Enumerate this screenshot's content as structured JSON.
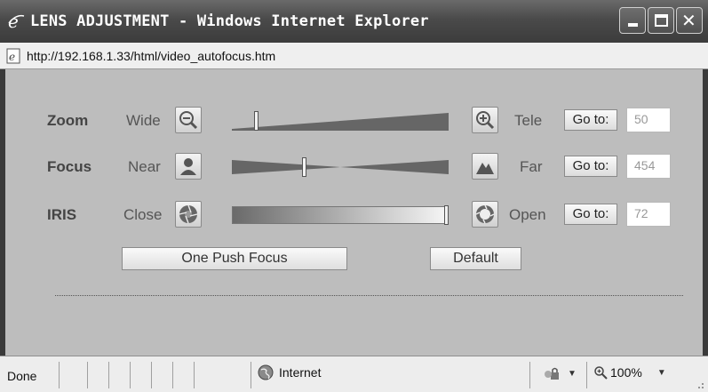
{
  "window": {
    "title": "LENS ADJUSTMENT - Windows Internet Explorer",
    "url": "http://192.168.1.33/html/video_autofocus.htm"
  },
  "controls": {
    "zoom": {
      "label": "Zoom",
      "min_label": "Wide",
      "max_label": "Tele",
      "goto_label": "Go to:",
      "value": "50",
      "position": 0.11,
      "min_icon": "zoom-out-icon",
      "max_icon": "zoom-in-icon"
    },
    "focus": {
      "label": "Focus",
      "min_label": "Near",
      "max_label": "Far",
      "goto_label": "Go to:",
      "value": "454",
      "position": 0.34,
      "min_icon": "person-icon",
      "max_icon": "mountain-icon"
    },
    "iris": {
      "label": "IRIS",
      "min_label": "Close",
      "max_label": "Open",
      "goto_label": "Go to:",
      "value": "72",
      "position": 0.99,
      "min_icon": "iris-closed-icon",
      "max_icon": "iris-open-icon"
    }
  },
  "buttons": {
    "one_push_focus": "One Push Focus",
    "default": "Default"
  },
  "status": {
    "text": "Done",
    "zone": "Internet",
    "zoom": "100%"
  }
}
